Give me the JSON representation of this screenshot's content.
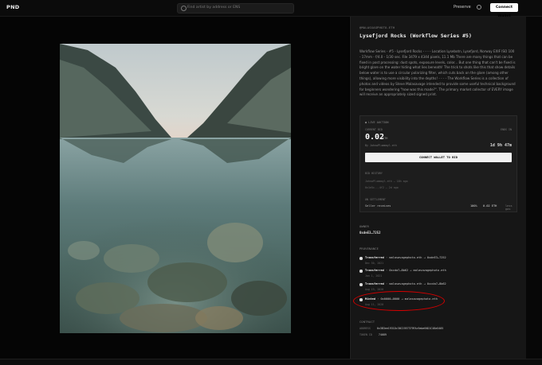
{
  "header": {
    "logo": "PND",
    "search_placeholder": "Find artist by address or ENS",
    "nav_preserve": "Preserve",
    "connect_label": "Connect Wallet"
  },
  "artwork": {
    "owner_handle": "@MALASXAGPHOTO.ETH",
    "title": "Lysefjord Rocks (Workflow Series #5)"
  },
  "description": "Workflow Series - #5 - Lysefjord Rocks - - - - Location Lysebotn, Lysefjord, Norway EXIF ISO 100 - 17mm - f/4.0 - 1/30 sec. File 3479 x 4344 pixels, 11.1 Mb There are many things that can be fixed in post processing: dust spots, exposure levels, color... But one thing that can't be fixed is bright glare on the water hiding what lies beneath! The trick to shots like this that show details below water is to use a circular polarizing filter, which cuts back on the glare (among other things), allowing more visibility into the depths! - - - - The Workflow Series is a collection of photos and videos by Steve Malasavage intended to provide some useful technical background for beginners wondering \"how was this made?\". The primary market collector of EVERY image will receive an appropriately sized signed print.",
  "auction": {
    "label": "● LIVE AUCTION",
    "current_bid_label": "CURRENT BID",
    "price": "0.02",
    "unit": "ETH",
    "by": "By JohnwPlummayl.eth",
    "ends_label": "ENDS IN",
    "ends": "1d 9h 47m",
    "bid_button": "CONNECT WALLET TO BID",
    "history_label": "BID HISTORY",
    "history": [
      {
        "text": "JohnwPlummayl.eth — 18h ago"
      },
      {
        "text": "0x1e5c...4f2 — 2d ago"
      }
    ],
    "settlement_label": "ON SETTLEMENT",
    "settlement_name": "Seller receives",
    "settlement_pct": "100%",
    "settlement_amount": "0.02 ETH",
    "settlement_gas": "less gas"
  },
  "owner_section": {
    "label": "OWNER",
    "value": "0xdeE3…7252"
  },
  "provenance": {
    "label": "PROVENANCE",
    "items": [
      {
        "event": "Transferred",
        "from": "malasavagephoto.eth",
        "to": "0xdeE3…7252",
        "date": "Dec 30, 2021"
      },
      {
        "event": "Transferred",
        "from": "0xcda7…8b62",
        "to": "malasavagephoto.eth",
        "date": "Jan 1, 2021"
      },
      {
        "event": "Transferred",
        "from": "malasavagephoto.eth",
        "to": "0xcda7…8b62",
        "date": "Aug 19, 2020"
      },
      {
        "event": "Minted",
        "from": "0x0000…0000",
        "to": "malasavagephoto.eth",
        "date": "Aug 11, 2020"
      }
    ]
  },
  "contract": {
    "label": "CONTRACT",
    "address_label": "ADDRESS",
    "address": "0x3B3ee1931Dc30C1957379FAc9aba94D1C48a5405",
    "token_label": "TOKEN ID",
    "token": "74089"
  },
  "colors": {
    "panel_bg": "#161616",
    "highlight": "#d40000",
    "button_bg": "#ffffff"
  }
}
